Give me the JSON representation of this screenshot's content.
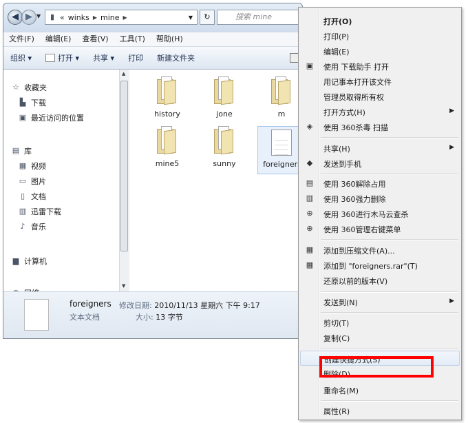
{
  "address": {
    "segments": [
      "«",
      "winks",
      "mine"
    ],
    "search_placeholder": "搜索 mine"
  },
  "menubar": [
    "文件(F)",
    "编辑(E)",
    "查看(V)",
    "工具(T)",
    "帮助(H)"
  ],
  "toolbar": [
    "组织 ▾",
    "打开 ▾",
    "共享 ▾",
    "打印",
    "新建文件夹"
  ],
  "nav": {
    "favorites": "收藏夹",
    "downloads": "下载",
    "recent": "最近访问的位置",
    "library": "库",
    "video": "视频",
    "pictures": "图片",
    "documents": "文档",
    "thunder": "迅雷下载",
    "music": "音乐",
    "computer": "计算机",
    "network": "网络"
  },
  "files": [
    "history",
    "jone",
    "m",
    "mine5",
    "sunny",
    "foreigners"
  ],
  "details": {
    "name": "foreigners",
    "modified_label": "修改日期:",
    "modified_value": "2010/11/13 星期六 下午 9:17",
    "type": "文本文档",
    "size_label": "大小:",
    "size_value": "13 字节"
  },
  "context_menu": [
    "打开(O)",
    "打印(P)",
    "编辑(E)",
    "使用 下载助手 打开",
    "用记事本打开该文件",
    "管理员取得所有权",
    "打开方式(H)",
    "使用 360杀毒 扫描",
    "共享(H)",
    "发送到手机",
    "使用 360解除占用",
    "使用 360强力删除",
    "使用 360进行木马云查杀",
    "使用 360管理右键菜单",
    "添加到压缩文件(A)...",
    "添加到 \"foreigners.rar\"(T)",
    "还原以前的版本(V)",
    "发送到(N)",
    "剪切(T)",
    "复制(C)",
    "创建快捷方式(S)",
    "删除(D)",
    "重命名(M)",
    "属性(R)"
  ],
  "colors": {
    "highlight": "#ff0000",
    "window_frame": "#dfe9f5",
    "menu_bg": "#f0f0f0"
  }
}
